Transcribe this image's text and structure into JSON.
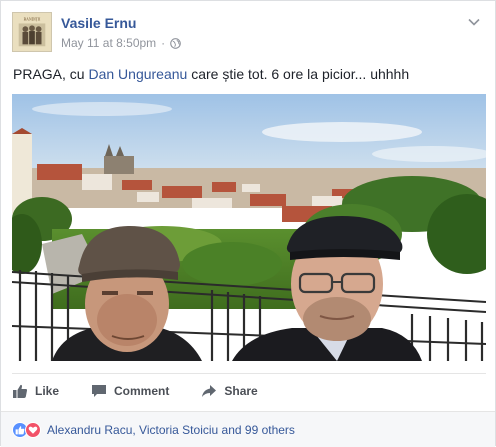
{
  "post": {
    "author": "Vasile Ernu",
    "timestamp": "May 11 at 8:50pm",
    "separator": "·",
    "privacy_icon": "globe-icon",
    "text_before": "PRAGA, cu ",
    "mention": "Dan Ungureanu",
    "text_after": " care știe tot. 6 ore la picior... uhhhh"
  },
  "actions": {
    "like_label": "Like",
    "comment_label": "Comment",
    "share_label": "Share"
  },
  "reactions": {
    "icons": [
      "like-reaction-icon",
      "love-reaction-icon"
    ],
    "summary": "Alexandru Racu, Victoria Stoiciu and 99 others"
  },
  "avatar": {
    "cover_text": "BANDIȚII"
  },
  "colors": {
    "link": "#365899",
    "meta": "#90949c",
    "action_text": "#4b4f56",
    "like_reaction": "#5890ff",
    "love_reaction": "#f25268"
  }
}
